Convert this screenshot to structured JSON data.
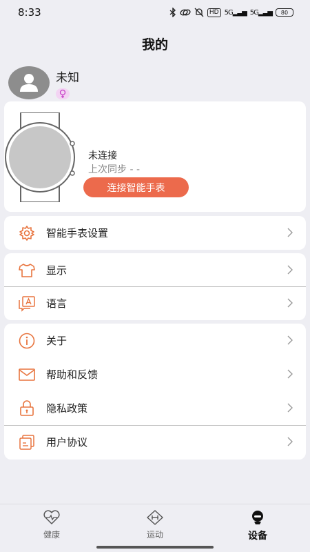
{
  "status_bar": {
    "time": "8:33",
    "hd_label": "HD",
    "signal1": "5G",
    "signal2": "5G",
    "battery": "80"
  },
  "header": {
    "title": "我的"
  },
  "profile": {
    "name": "未知",
    "gender_icon": "female-icon"
  },
  "device": {
    "status": "未连接",
    "last_sync": "上次同步 - -",
    "connect_label": "连接智能手表"
  },
  "menu": {
    "watch_settings": {
      "label": "智能手表设置",
      "icon": "gear-icon"
    },
    "display": {
      "label": "显示",
      "icon": "tshirt-icon"
    },
    "language": {
      "label": "语言",
      "icon": "language-icon"
    },
    "about": {
      "label": "关于",
      "icon": "info-icon"
    },
    "help": {
      "label": "帮助和反馈",
      "icon": "mail-icon"
    },
    "privacy": {
      "label": "隐私政策",
      "icon": "lock-icon"
    },
    "agreement": {
      "label": "用户协议",
      "icon": "document-icon"
    }
  },
  "tabs": [
    {
      "label": "健康",
      "icon": "heart-icon"
    },
    {
      "label": "运动",
      "icon": "dumbbell-icon"
    },
    {
      "label": "设备",
      "icon": "device-icon",
      "active": true
    }
  ],
  "colors": {
    "accent": "#ec6a4c",
    "background": "#eeeef3",
    "card": "#ffffff"
  }
}
